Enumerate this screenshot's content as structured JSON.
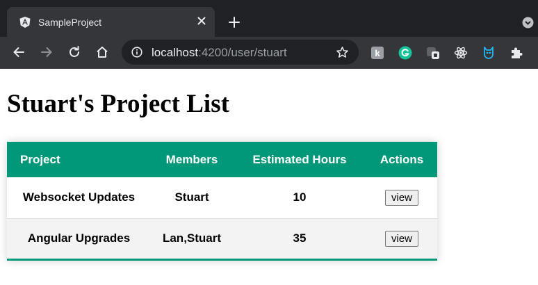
{
  "browser": {
    "tab": {
      "title": "SampleProject",
      "favicon": "angular-logo-icon"
    },
    "url": {
      "host": "localhost",
      "rest": ":4200/user/stuart"
    },
    "colors": {
      "frame": "#202124",
      "toolbar": "#35363a",
      "text": "#e8eaed",
      "muted": "#9aa0a6"
    },
    "extensions": [
      "extension-k-icon",
      "grammarly-icon",
      "extension-toggle-icon",
      "react-devtools-icon",
      "owl-extension-icon",
      "extensions-puzzle-icon"
    ]
  },
  "page": {
    "title": "Stuart's Project List",
    "table": {
      "accent": "#009879",
      "headers": [
        "Project",
        "Members",
        "Estimated Hours",
        "Actions"
      ],
      "rows": [
        {
          "project": "Websocket Updates",
          "members": "Stuart",
          "hours": "10",
          "action": "view"
        },
        {
          "project": "Angular Upgrades",
          "members": "Lan,Stuart",
          "hours": "35",
          "action": "view"
        }
      ]
    }
  }
}
